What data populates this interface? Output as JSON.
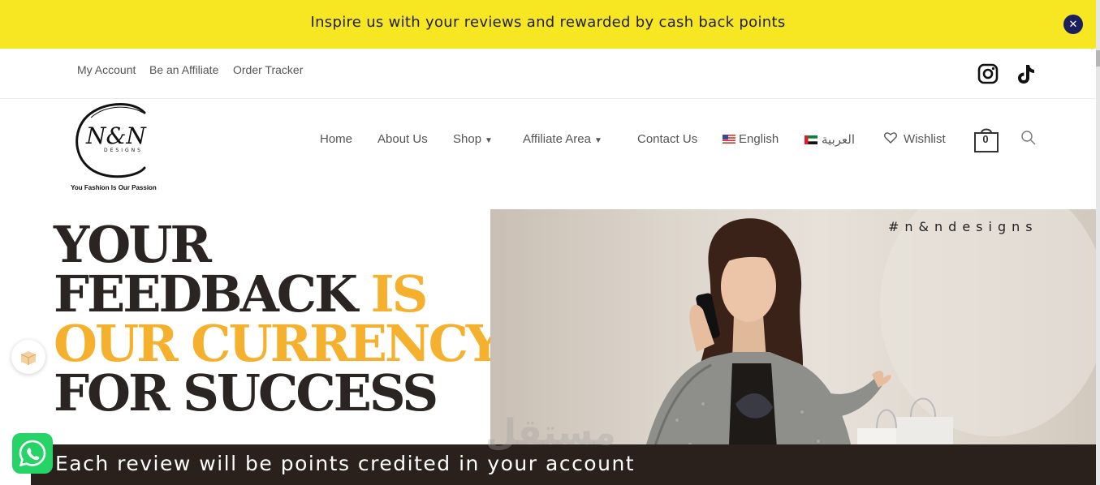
{
  "announcement": {
    "text": "Inspire us with your reviews and rewarded by cash back points",
    "close_icon": "close-icon",
    "background": "#f7e622"
  },
  "topbar": {
    "links": [
      "My Account",
      "Be an Affiliate",
      "Order Tracker"
    ],
    "social_icons": [
      "instagram-icon",
      "tiktok-icon"
    ]
  },
  "logo": {
    "mark": "N&N",
    "subtitle": "DESIGNS",
    "tagline": "You Fashion Is Our Passion"
  },
  "nav": {
    "home": "Home",
    "about": "About Us",
    "shop": "Shop",
    "affiliate": "Affiliate Area",
    "contact": "Contact Us",
    "english": "English",
    "arabic": "العربية",
    "wishlist": "Wishlist",
    "cart_count": "0"
  },
  "hero": {
    "line1": "YOUR",
    "line2": "FEEDBACK",
    "line2_accent": "IS",
    "line3": "OUR CURRENCY",
    "line4": "FOR SUCCESS",
    "hashtag": "#n&ndesigns",
    "band_text": "Each review will be points credited in your account",
    "watermark": "مستقل",
    "accent_color": "#f5b12e",
    "dark_color": "#2a2522"
  },
  "floating": {
    "gift_icon": "gift-box-icon",
    "whatsapp_icon": "whatsapp-icon"
  }
}
